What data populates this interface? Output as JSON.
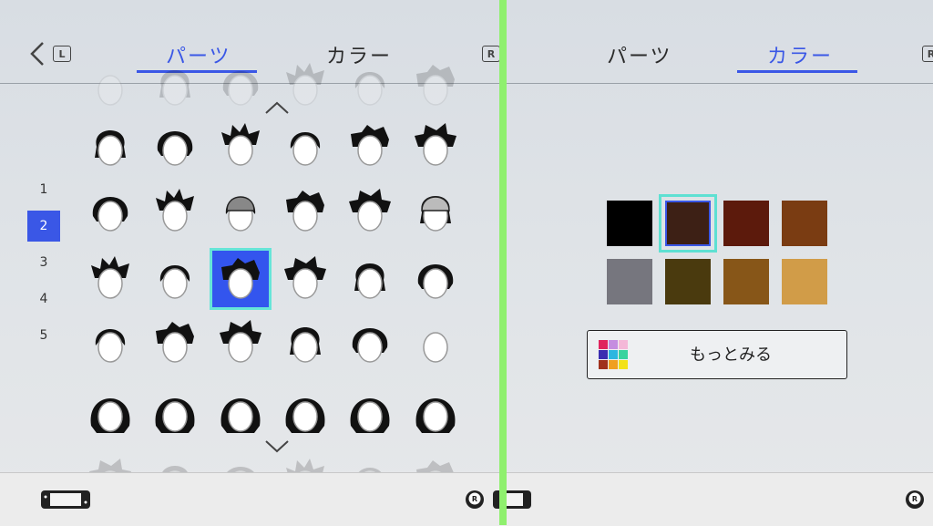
{
  "left_panel": {
    "tabs": [
      {
        "label": "パーツ",
        "active": true
      },
      {
        "label": "カラー",
        "active": false
      }
    ],
    "shoulder_left": "L",
    "shoulder_right": "R",
    "page_numbers": [
      {
        "label": "1",
        "active": false
      },
      {
        "label": "2",
        "active": true
      },
      {
        "label": "3",
        "active": false
      },
      {
        "label": "4",
        "active": false
      },
      {
        "label": "5",
        "active": false
      }
    ],
    "hair_styles_rows": 5,
    "hair_styles_cols": 6,
    "selected_cell": {
      "row": 2,
      "col": 2
    }
  },
  "right_panel": {
    "tabs": [
      {
        "label": "パーツ",
        "active": false
      },
      {
        "label": "カラー",
        "active": true
      }
    ],
    "shoulder_right": "R",
    "swatches": [
      {
        "color": "#000000",
        "selected": false
      },
      {
        "color": "#3d2015",
        "selected": true
      },
      {
        "color": "#5c1a0c",
        "selected": false
      },
      {
        "color": "#7a3c12",
        "selected": false
      },
      {
        "color": "#76767e",
        "selected": false
      },
      {
        "color": "#4a3a0e",
        "selected": false
      },
      {
        "color": "#875618",
        "selected": false
      },
      {
        "color": "#d19c48",
        "selected": false
      }
    ],
    "more_button_label": "もっとみる",
    "more_icon_colors": [
      "#e0245e",
      "#c58de0",
      "#f4b8d8",
      "#3b2db0",
      "#2bb6e0",
      "#39d39f",
      "#a0311c",
      "#f0a020",
      "#f3e21a"
    ]
  },
  "footer": {
    "left_icon": "handheld-console-icon",
    "right_icons": [
      "r-stick-icon",
      "handheld-console-icon",
      "r-stick-icon"
    ]
  },
  "accent_color": "#3a57e6",
  "selection_color": "#5ee0d2",
  "divider_color": "#8ff06e"
}
